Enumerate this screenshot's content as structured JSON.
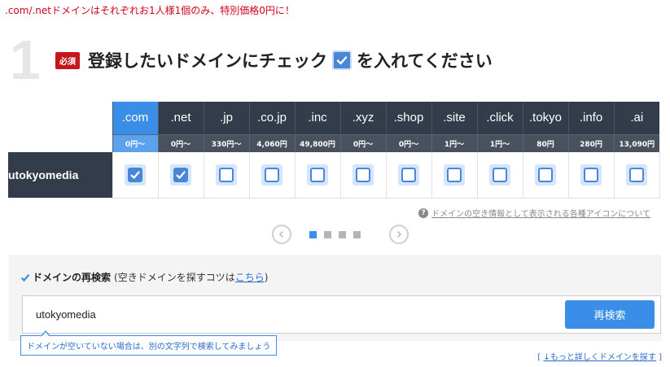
{
  "notice": ".com/.netドメインはそれぞれお1人様1個のみ、特別価格0円に！",
  "step": {
    "number": "1",
    "badge": "必須",
    "heading_before": "登録したいドメインにチェック",
    "heading_after": "を入れてください"
  },
  "colors": {
    "accent": "#3b8ee8",
    "dark": "#333c4a",
    "required": "#c4161c"
  },
  "domain_name": "utokyomedia",
  "tlds": [
    {
      "label": ".com",
      "price": "0円～",
      "checked": true,
      "active": true
    },
    {
      "label": ".net",
      "price": "0円～",
      "checked": true,
      "active": false
    },
    {
      "label": ".jp",
      "price": "330円～",
      "checked": false,
      "active": false
    },
    {
      "label": ".co.jp",
      "price": "4,060円",
      "checked": false,
      "active": false
    },
    {
      "label": ".inc",
      "price": "49,800円",
      "checked": false,
      "active": false
    },
    {
      "label": ".xyz",
      "price": "0円～",
      "checked": false,
      "active": false
    },
    {
      "label": ".shop",
      "price": "0円～",
      "checked": false,
      "active": false
    },
    {
      "label": ".site",
      "price": "1円～",
      "checked": false,
      "active": false
    },
    {
      "label": ".click",
      "price": "1円～",
      "checked": false,
      "active": false
    },
    {
      "label": ".tokyo",
      "price": "80円",
      "checked": false,
      "active": false
    },
    {
      "label": ".info",
      "price": "280円",
      "checked": false,
      "active": false
    },
    {
      "label": ".ai",
      "price": "13,090円",
      "checked": false,
      "active": false
    }
  ],
  "icon_info_link": "ドメインの空き情報として表示される各種アイコンについて",
  "pager": {
    "pages": 4,
    "current": 1
  },
  "research": {
    "title": "ドメインの再検索",
    "sub_before": "(空きドメインを探すコツは",
    "sub_link": "こちら",
    "sub_after": ")",
    "input_value": "utokyomedia",
    "button_label": "再検索",
    "tooltip": "ドメインが空いていない場合は、別の文字列で検索してみましょう"
  },
  "detail_link": {
    "open": "[",
    "label": "↓もっと詳しくドメインを探す",
    "close": "]"
  }
}
